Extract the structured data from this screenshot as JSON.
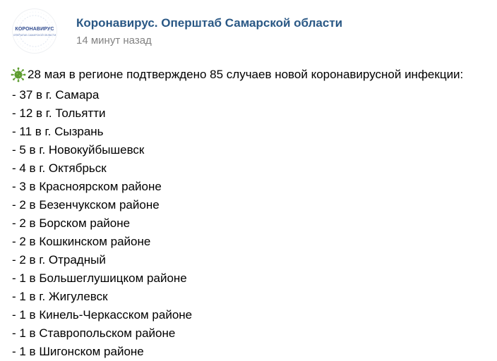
{
  "header": {
    "avatar": {
      "title": "КОРОНАВИРУС",
      "subtitle": "ОПЕРШТАБ САМАРСКОЙ ОБЛАСТИ"
    },
    "author_name": "Коронавирус. Оперштаб Самарской области",
    "time": "14 минут назад"
  },
  "post": {
    "lead_icon": "virus-emoji",
    "lead": "28 мая в регионе подтверждено 85 случаев новой коронавирусной инфекции:",
    "items": [
      "- 37 в г. Самара",
      "- 12 в г. Тольятти",
      "- 11 в г. Сызрань",
      "- 5 в г. Новокуйбышевск",
      "- 4 в г. Октябрьск",
      "- 3 в Красноярском районе",
      "- 2 в Безенчукском районе",
      "- 2 в Борском районе",
      "- 2 в Кошкинском районе",
      "- 2 в г. Отрадный",
      "- 1 в Большеглушицком районе",
      "- 1 в г. Жигулевск",
      "- 1 в Кинель-Черкасском районе",
      "- 1 в Ставропольском районе",
      "- 1 в Шигонском районе"
    ]
  },
  "colors": {
    "author_link": "#2a5885",
    "time_text": "#828282",
    "avatar_text": "#2f4a8f",
    "virus_icon": "#5d9c2f"
  }
}
